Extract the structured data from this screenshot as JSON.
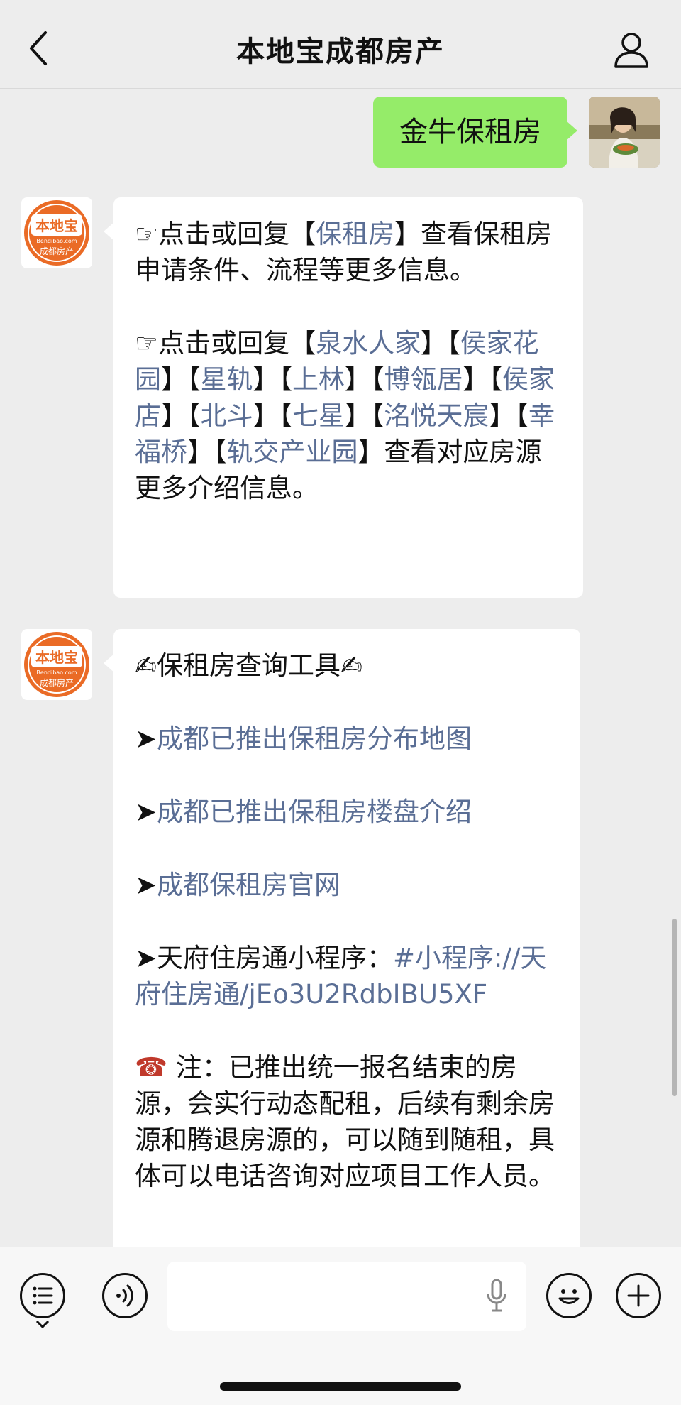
{
  "header": {
    "title": "本地宝成都房产"
  },
  "icons": {
    "back": "chevron-left-icon",
    "profile": "person-icon",
    "menu": "menu-list-icon",
    "voice": "voice-icon",
    "mic": "microphone-icon",
    "emoji": "emoji-icon",
    "plus": "plus-icon"
  },
  "logo": {
    "brand": "本地宝",
    "domain": "Bendibao.com",
    "sub": "成都房产"
  },
  "messages": {
    "user": {
      "text": "金牛保租房"
    },
    "reply1": {
      "p1_pre": "☞点击或回复【",
      "p1_link": "保租房",
      "p1_post": "】查看保租房申请条件、流程等更多信息。",
      "p2_pre": "☞点击或回复【",
      "p2_links": [
        "泉水人家",
        "侯家花园",
        "星轨",
        "上林",
        "博瓴居",
        "侯家店",
        "北斗",
        "七星",
        "洺悦天宸",
        "幸福桥",
        "轨交产业园"
      ],
      "p2_post": "】查看对应房源更多介绍信息。"
    },
    "reply2": {
      "heading": "✍保租房查询工具✍",
      "arrow": "➤",
      "link1": "成都已推出保租房分布地图",
      "link2": "成都已推出保租房楼盘介绍",
      "link3": "成都保租房官网",
      "mini_label": "天府住房通小程序：",
      "mini_link": "#小程序://天府住房通/jEo3U2RdbIBU5XF",
      "note_icon": "☎",
      "note_text": " 注：已推出统一报名结束的房源，会实行动态配租，后续有剩余房源和腾退房源的，可以随到随租，具体可以电话咨询对应项目工作人员。"
    }
  }
}
